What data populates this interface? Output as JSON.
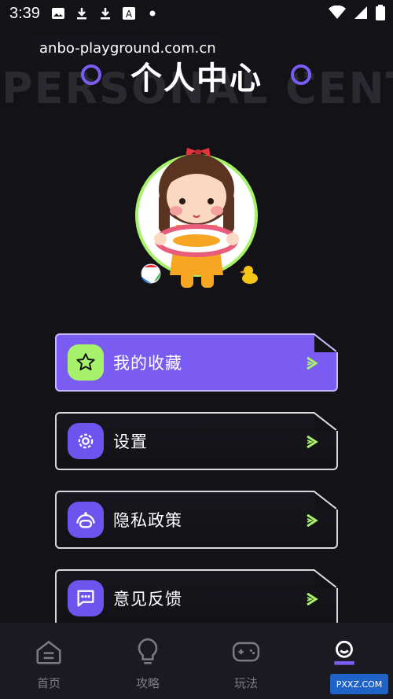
{
  "status_bar": {
    "time": "3:39",
    "icons": [
      "image-icon",
      "download-icon",
      "download-icon",
      "text-badge-icon",
      "dot-icon"
    ],
    "right_icons": [
      "wifi-icon",
      "signal-icon",
      "battery-icon"
    ]
  },
  "header": {
    "url": "anbo-playground.com.cn",
    "bg_text": "PERSONAL CENTER",
    "title": "个人中心"
  },
  "menu": [
    {
      "label": "我的收藏",
      "icon": "star-icon",
      "active": true
    },
    {
      "label": "设置",
      "icon": "gear-icon",
      "active": false
    },
    {
      "label": "隐私政策",
      "icon": "privacy-icon",
      "active": false
    },
    {
      "label": "意见反馈",
      "icon": "feedback-icon",
      "active": false
    }
  ],
  "bottom_nav": [
    {
      "label": "首页",
      "icon": "home-icon"
    },
    {
      "label": "攻略",
      "icon": "bulb-icon"
    },
    {
      "label": "玩法",
      "icon": "gamepad-icon"
    },
    {
      "label": "",
      "icon": "profile-icon",
      "active": true
    }
  ],
  "watermark": "PXXZ.COM",
  "colors": {
    "accent": "#7b5cf3",
    "lime": "#a6f36b",
    "bg": "#131217"
  }
}
